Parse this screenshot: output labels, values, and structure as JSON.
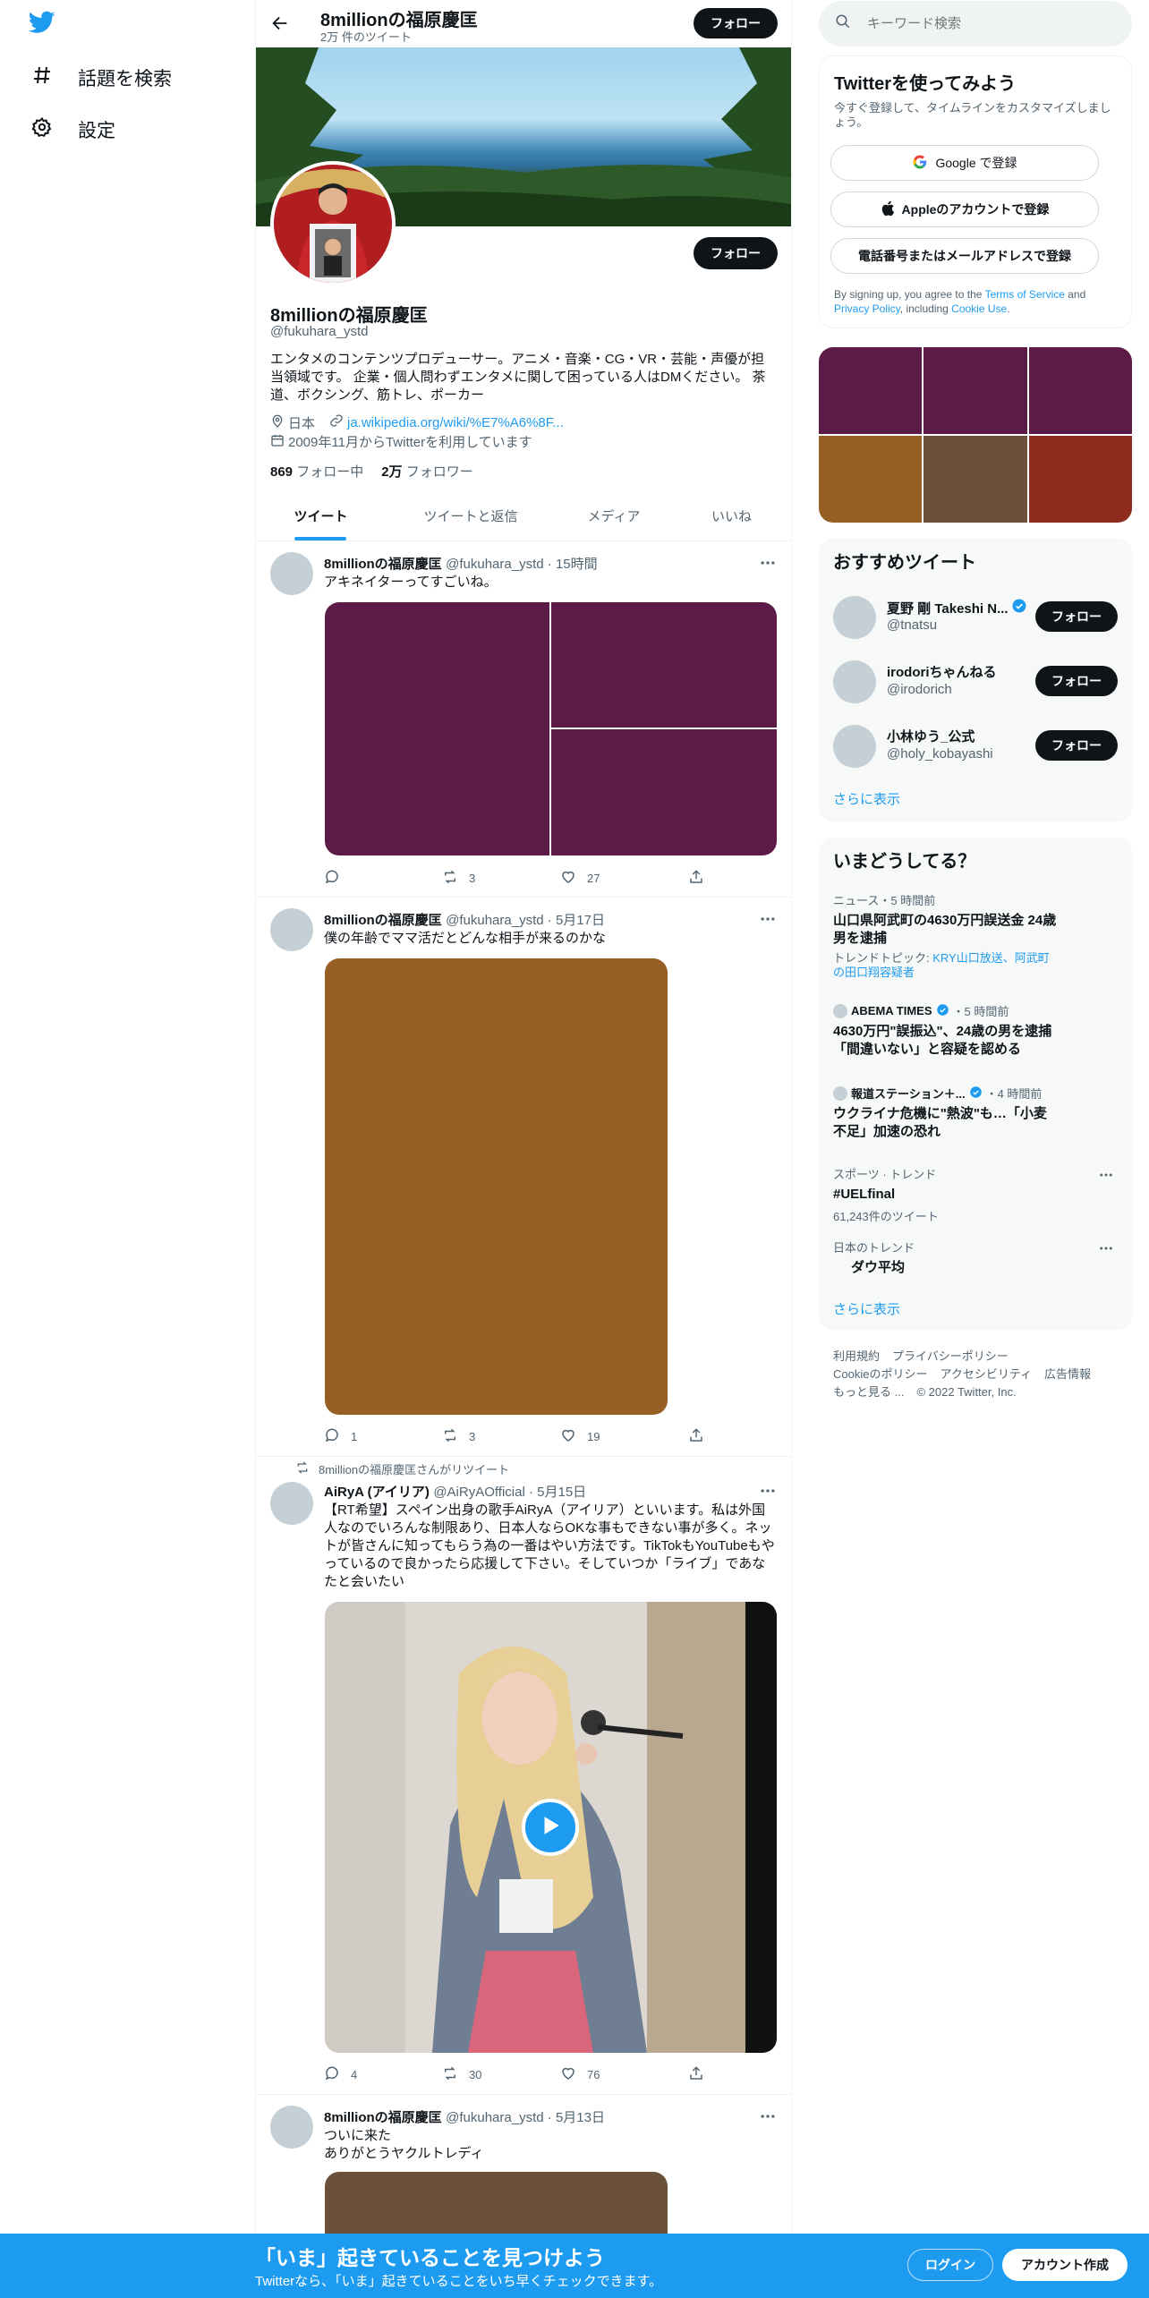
{
  "nav": {
    "explore_label": "話題を検索",
    "settings_label": "設定"
  },
  "header": {
    "title": "8millionの福原慶匡",
    "subtitle": "2万 件のツイート",
    "follow_label": "フォロー"
  },
  "profile": {
    "name": "8millionの福原慶匡",
    "handle": "@fukuhara_ystd",
    "bio": "エンタメのコンテンツプロデューサー。アニメ・音楽・CG・VR・芸能・声優が担当領域です。 企業・個人問わずエンタメに関して困っている人はDMください。 茶道、ボクシング、筋トレ、ポーカー",
    "location": "日本",
    "link": "ja.wikipedia.org/wiki/%E7%A6%8F...",
    "joined": "2009年11月からTwitterを利用しています",
    "following_count": "869",
    "following_label": "フォロー中",
    "followers_count": "2万",
    "followers_label": "フォロワー",
    "follow_label": "フォロー"
  },
  "tabs": [
    "ツイート",
    "ツイートと返信",
    "メディア",
    "いいね"
  ],
  "tweets": [
    {
      "name": "8millionの福原慶匡",
      "handle": "@fukuhara_ystd",
      "time": "15時間",
      "text": "アキネイターってすごいね。",
      "replies": "",
      "retweets": "3",
      "likes": "27"
    },
    {
      "name": "8millionの福原慶匡",
      "handle": "@fukuhara_ystd",
      "time": "5月17日",
      "text": "僕の年齢でママ活だとどんな相手が来るのかな",
      "replies": "1",
      "retweets": "3",
      "likes": "19"
    },
    {
      "retweeted_by": "8millionの福原慶匡さんがリツイート",
      "name": "AiRyA (アイリア)",
      "handle": "@AiRyAOfficial",
      "time": "5月15日",
      "text": "【RT希望】スペイン出身の歌手AiRyA（アイリア）といいます。私は外国人なのでいろんな制限あり、日本人ならOKな事もできない事が多く。ネットが皆さんに知ってもらう為の一番はやい方法です。TikTokもYouTubeもやっているので良かったら応援して下さい。そしていつか「ライブ」であなたと会いたい",
      "replies": "4",
      "retweets": "30",
      "likes": "76"
    },
    {
      "name": "8millionの福原慶匡",
      "handle": "@fukuhara_ystd",
      "time": "5月13日",
      "text_line1": "ついに来た",
      "text_line2": "ありがとうヤクルトレディ"
    }
  ],
  "search": {
    "placeholder": "キーワード検索"
  },
  "signup": {
    "title": "Twitterを使ってみよう",
    "subtitle": "今すぐ登録して、タイムラインをカスタマイズしましょう。",
    "google_label": "Google で登録",
    "apple_label": "Appleのアカウントで登録",
    "phone_label": "電話番号またはメールアドレスで登録",
    "terms_prefix": "By signing up, you agree to the ",
    "terms_link": "Terms of Service",
    "terms_and": " and ",
    "privacy_link": "Privacy Policy",
    "including": ", including ",
    "cookie_link": "Cookie Use",
    "period": "."
  },
  "recommended": {
    "title": "おすすめツイート",
    "users": [
      {
        "name": "夏野 剛 Takeshi N...",
        "handle": "@tnatsu",
        "verified": true
      },
      {
        "name": "irodoriちゃんねる",
        "handle": "@irodorich",
        "verified": false
      },
      {
        "name": "小林ゆう_公式",
        "handle": "@holy_kobayashi",
        "verified": false
      }
    ],
    "follow_label": "フォロー",
    "show_more": "さらに表示"
  },
  "trends": {
    "title": "いまどうしてる？",
    "items": [
      {
        "category": "ニュース・5 時間前",
        "title": "山口県阿武町の4630万円誤送金 24歳男を逮捕",
        "topic_prefix": "トレンドトピック: ",
        "topic_links": "KRY山口放送、阿武町の田口翔容疑者"
      },
      {
        "source": "ABEMA TIMES",
        "time": "・5 時間前",
        "title": "4630万円\"誤振込\"、24歳の男を逮捕 「間違いない」と容疑を認める"
      },
      {
        "source": "報道ステーション＋...",
        "time": "・4 時間前",
        "title": "ウクライナ危機に\"熱波\"も…「小麦不足」加速の恐れ"
      },
      {
        "category": "スポーツ · トレンド",
        "title": "#UELfinal",
        "count": "61,243件のツイート"
      },
      {
        "category": "日本のトレンド",
        "title": "ダウ平均"
      }
    ],
    "show_more": "さらに表示"
  },
  "footer": {
    "terms": "利用規約",
    "privacy": "プライバシーポリシー",
    "cookie": "Cookieのポリシー",
    "accessibility": "アクセシビリティ",
    "ads": "広告情報",
    "more": "もっと見る ...",
    "copyright": "© 2022 Twitter, Inc."
  },
  "bottom_bar": {
    "title": "「いま」起きていることを見つけよう",
    "subtitle": "Twitterなら、「いま」起きていることをいち早くチェックできます。",
    "login_label": "ログイン",
    "signup_label": "アカウント作成"
  },
  "colors": {
    "accent": "#1d9bf0",
    "photo_purple": "#5c1a47",
    "photo_orange": "#965f24",
    "photo_brown": "#6b513a",
    "photo_red": "#8e2a1e"
  }
}
